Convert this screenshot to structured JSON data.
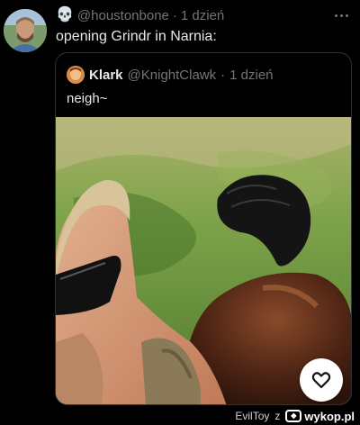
{
  "tweet": {
    "emoji": "💀",
    "handle": "@houstonbone",
    "separator": "·",
    "time": "1 dzień",
    "text": "opening Grindr in Narnia:",
    "more_icon": "more-horizontal-icon"
  },
  "quote": {
    "name": "Klark",
    "handle": "@KnightClawk",
    "separator": "·",
    "time": "1 dzień",
    "text": "neigh~"
  },
  "like_icon": "heart-icon",
  "footer": {
    "author": "EvilToy",
    "joiner": "z",
    "brand": "wykop.pl"
  }
}
